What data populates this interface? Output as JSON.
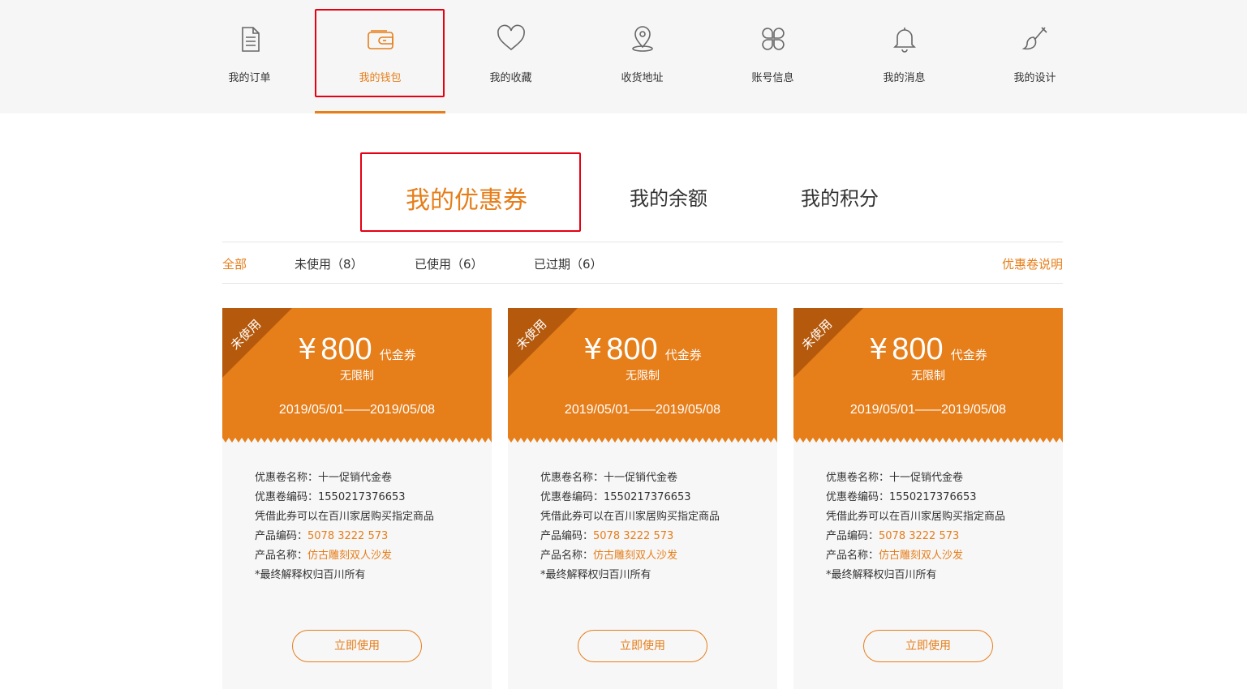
{
  "nav": [
    {
      "label": "我的订单",
      "icon": "document-icon"
    },
    {
      "label": "我的钱包",
      "icon": "wallet-icon"
    },
    {
      "label": "我的收藏",
      "icon": "heart-icon"
    },
    {
      "label": "收货地址",
      "icon": "location-pin-icon"
    },
    {
      "label": "账号信息",
      "icon": "clover-grid-icon"
    },
    {
      "label": "我的消息",
      "icon": "bell-icon"
    },
    {
      "label": "我的设计",
      "icon": "paint-brush-icon"
    }
  ],
  "nav_active_index": 1,
  "section_tabs": [
    "我的优惠券",
    "我的余额",
    "我的积分"
  ],
  "filters": [
    "全部",
    "未使用（8）",
    "已使用（6）",
    "已过期（6）"
  ],
  "filter_help": "优惠卷说明",
  "colors": {
    "accent": "#e67e1a",
    "highlight_box": "#e60012",
    "ribbon": "#b55a0d"
  },
  "coupons": [
    {
      "status": "未使用",
      "currency": "¥",
      "amount": "800",
      "type": "代金券",
      "limit": "无限制",
      "dates": "2019/05/01——2019/05/08",
      "name_label": "优惠卷名称：",
      "name": "十一促销代金卷",
      "code_label": "优惠卷编码：",
      "code": "1550217376653",
      "desc": "凭借此券可以在百川家居购买指定商品",
      "product_code_label": "产品编码：",
      "product_code": "5078 3222 573",
      "product_name_label": "产品名称：",
      "product_name": "仿古雕刻双人沙发",
      "note": "*最终解释权归百川所有",
      "button": "立即使用"
    },
    {
      "status": "未使用",
      "currency": "¥",
      "amount": "800",
      "type": "代金券",
      "limit": "无限制",
      "dates": "2019/05/01——2019/05/08",
      "name_label": "优惠卷名称：",
      "name": "十一促销代金卷",
      "code_label": "优惠卷编码：",
      "code": "1550217376653",
      "desc": "凭借此券可以在百川家居购买指定商品",
      "product_code_label": "产品编码：",
      "product_code": "5078 3222 573",
      "product_name_label": "产品名称：",
      "product_name": "仿古雕刻双人沙发",
      "note": "*最终解释权归百川所有",
      "button": "立即使用"
    },
    {
      "status": "未使用",
      "currency": "¥",
      "amount": "800",
      "type": "代金券",
      "limit": "无限制",
      "dates": "2019/05/01——2019/05/08",
      "name_label": "优惠卷名称：",
      "name": "十一促销代金卷",
      "code_label": "优惠卷编码：",
      "code": "1550217376653",
      "desc": "凭借此券可以在百川家居购买指定商品",
      "product_code_label": "产品编码：",
      "product_code": "5078 3222 573",
      "product_name_label": "产品名称：",
      "product_name": "仿古雕刻双人沙发",
      "note": "*最终解释权归百川所有",
      "button": "立即使用"
    }
  ]
}
